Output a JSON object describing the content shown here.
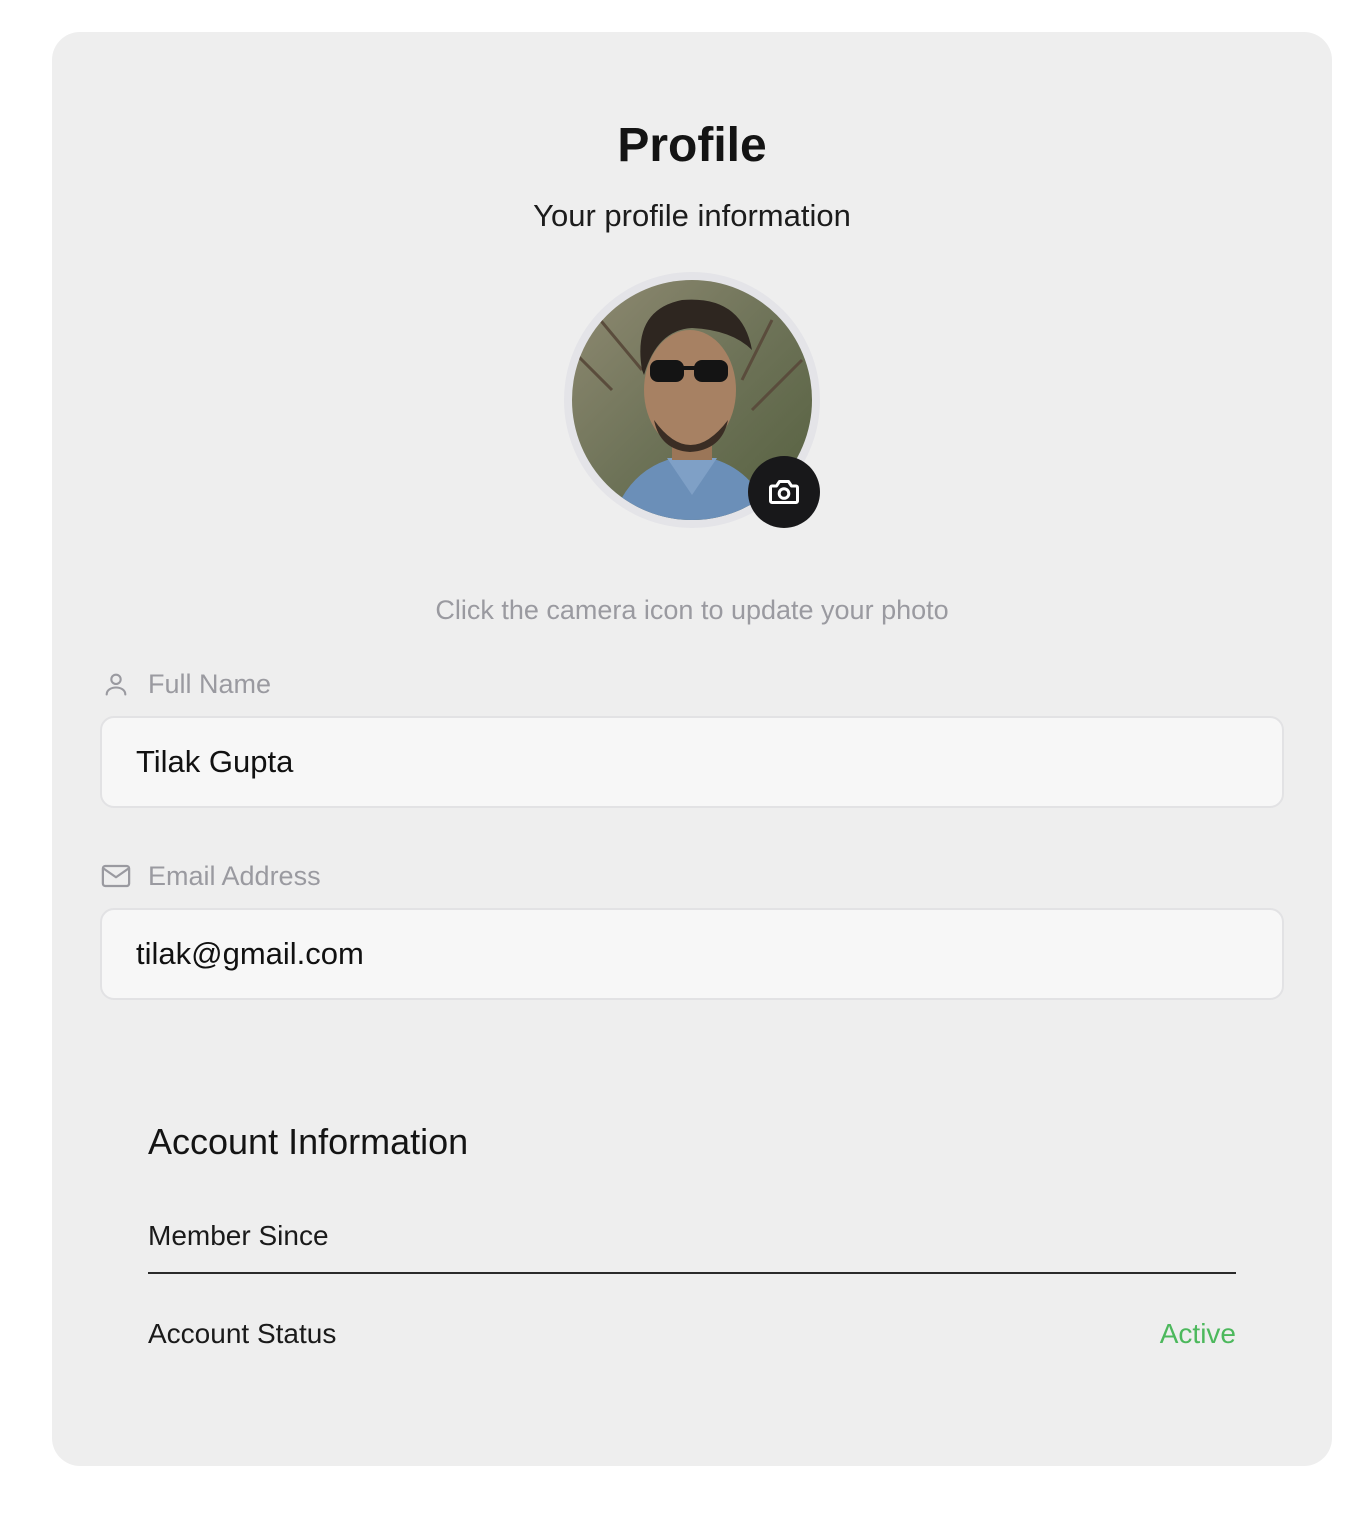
{
  "header": {
    "title": "Profile",
    "subtitle": "Your profile information"
  },
  "avatar": {
    "hint": "Click the camera icon to update your photo",
    "camera_icon": "camera-icon"
  },
  "fields": {
    "full_name": {
      "label": "Full Name",
      "value": "Tilak Gupta",
      "icon": "user-icon"
    },
    "email": {
      "label": "Email Address",
      "value": "tilak@gmail.com",
      "icon": "mail-icon"
    }
  },
  "account": {
    "title": "Account Information",
    "member_since_label": "Member Since",
    "member_since_value": "",
    "status_label": "Account Status",
    "status_value": "Active"
  },
  "colors": {
    "card_bg": "#eeeeee",
    "status_active": "#4cb85c",
    "camera_button": "#18181a"
  }
}
